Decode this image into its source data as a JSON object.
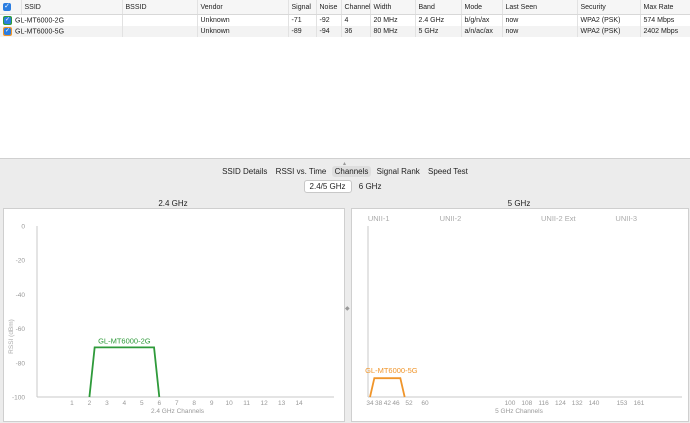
{
  "table": {
    "columns": [
      "SSID",
      "BSSID",
      "Vendor",
      "Signal",
      "Noise",
      "Channel",
      "Width",
      "Band",
      "Mode",
      "Last Seen",
      "Security",
      "Max Rate"
    ],
    "rows": [
      {
        "ssid": "GL-MT6000-2G",
        "bssid": "",
        "vendor": "Unknown",
        "signal": "-71",
        "noise": "-92",
        "channel": "4",
        "width": "20 MHz",
        "band": "2.4 GHz",
        "mode": "b/g/n/ax",
        "last_seen": "now",
        "security": "WPA2 (PSK)",
        "max_rate": "574 Mbps",
        "color": "#2e9a3a"
      },
      {
        "ssid": "GL-MT6000-5G",
        "bssid": "",
        "vendor": "Unknown",
        "signal": "-89",
        "noise": "-94",
        "channel": "36",
        "width": "80 MHz",
        "band": "5 GHz",
        "mode": "a/n/ac/ax",
        "last_seen": "now",
        "security": "WPA2 (PSK)",
        "max_rate": "2402 Mbps",
        "color": "#f0952a"
      }
    ]
  },
  "tabs": [
    "SSID Details",
    "RSSI vs. Time",
    "Channels",
    "Signal Rank",
    "Speed Test"
  ],
  "active_tab": "Channels",
  "subtabs": [
    "2.4/5 GHz",
    "6 GHz"
  ],
  "active_subtab": "2.4/5 GHz",
  "panel_24": {
    "title": "2.4 GHz",
    "xlabel": "2.4 GHz Channels",
    "ylabel": "RSSI (dBm)",
    "yticks": [
      "0",
      "-20",
      "-40",
      "-60",
      "-80",
      "-100"
    ],
    "xticks": [
      "1",
      "2",
      "3",
      "4",
      "5",
      "6",
      "7",
      "8",
      "9",
      "10",
      "11",
      "12",
      "13",
      "14"
    ]
  },
  "panel_5": {
    "title": "5 GHz",
    "xlabel": "5 GHz Channels",
    "bands": [
      "UNII-1",
      "UNII-2",
      "UNII-2 Ext",
      "UNII-3"
    ],
    "xticks": [
      "34",
      "38",
      "42",
      "46",
      "52",
      "60",
      "100",
      "108",
      "116",
      "124",
      "132",
      "140",
      "153",
      "161"
    ]
  },
  "chart_data": [
    {
      "type": "area",
      "title": "2.4 GHz",
      "xlabel": "2.4 GHz Channels",
      "ylabel": "RSSI (dBm)",
      "ylim": [
        -100,
        0
      ],
      "xlim": [
        -1,
        16
      ],
      "series": [
        {
          "name": "GL-MT6000-2G",
          "color": "#2e9a3a",
          "center_channel": 4,
          "rssi": -71,
          "x": [
            2,
            2.3,
            5.7,
            6
          ],
          "y": [
            -100,
            -71,
            -71,
            -100
          ]
        }
      ]
    },
    {
      "type": "area",
      "title": "5 GHz",
      "xlabel": "5 GHz Channels",
      "ylim": [
        -100,
        0
      ],
      "series": [
        {
          "name": "GL-MT6000-5G",
          "color": "#f0952a",
          "center_channel": 42,
          "rssi": -89,
          "x": [
            34,
            36,
            48,
            50
          ],
          "y": [
            -100,
            -89,
            -89,
            -100
          ]
        }
      ]
    }
  ]
}
